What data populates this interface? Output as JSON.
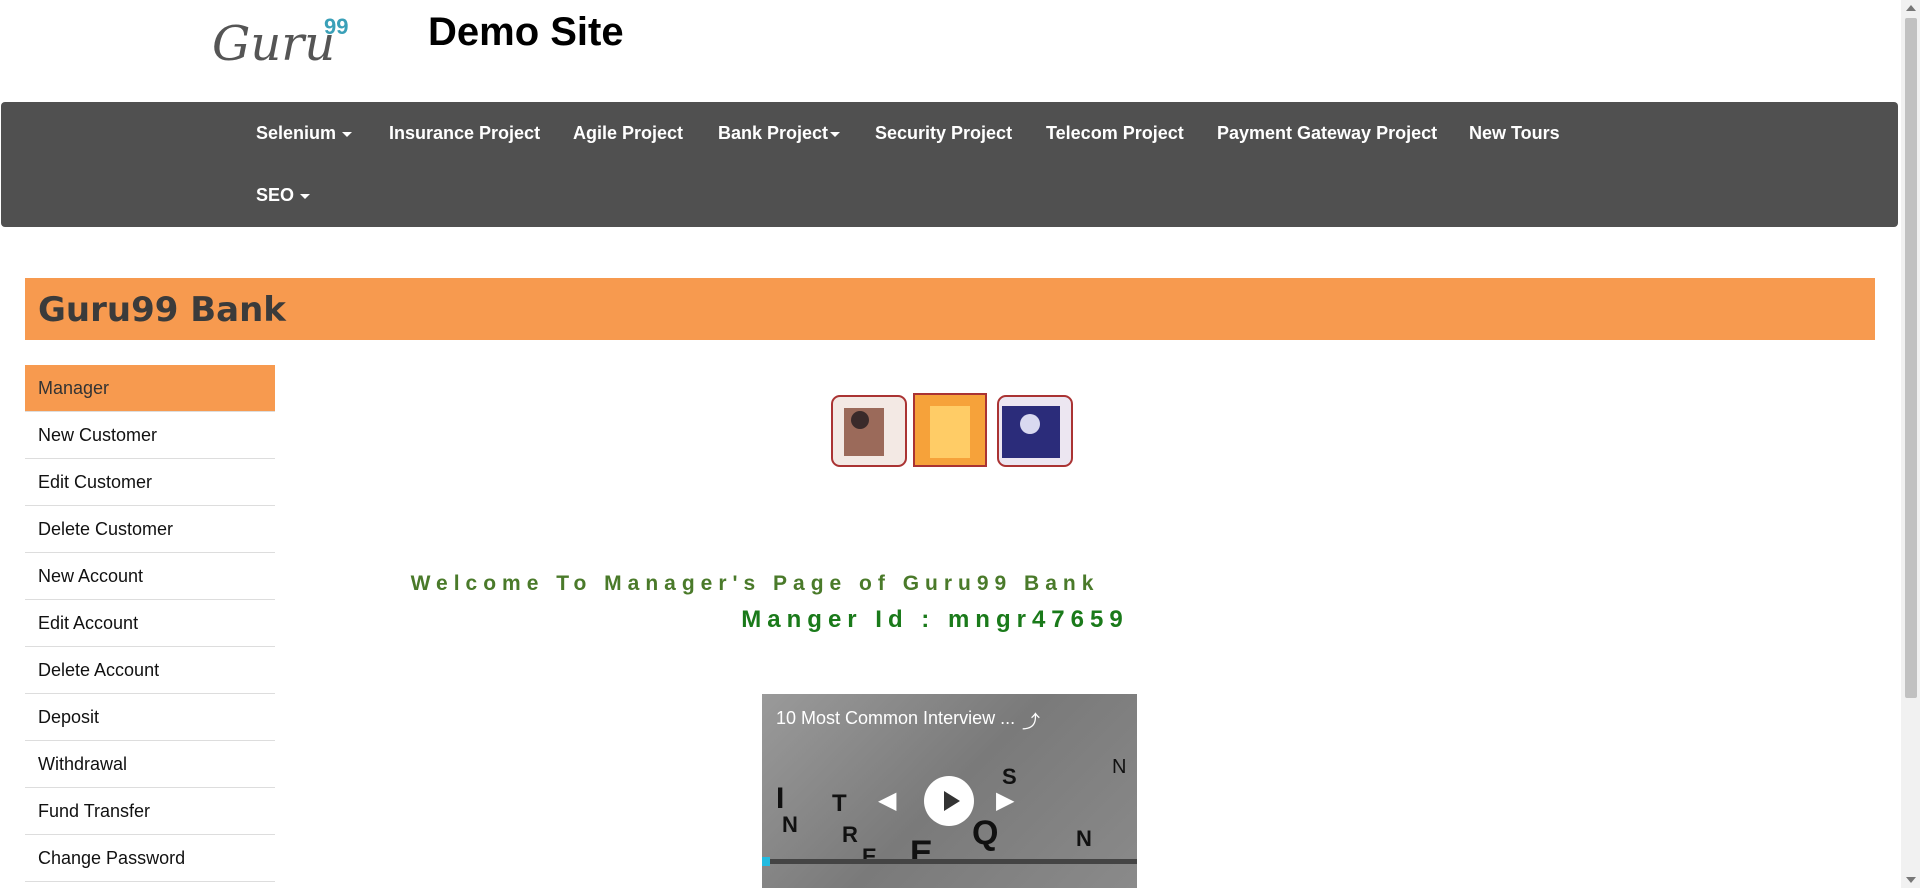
{
  "header": {
    "logo_text": "Guru",
    "logo_sup": "99",
    "site_title": "Demo Site"
  },
  "nav": {
    "items": [
      {
        "label": "Selenium",
        "dropdown": true
      },
      {
        "label": "Insurance Project",
        "dropdown": false
      },
      {
        "label": "Agile Project",
        "dropdown": false
      },
      {
        "label": "Bank Project",
        "dropdown": true
      },
      {
        "label": "Security Project",
        "dropdown": false
      },
      {
        "label": "Telecom Project",
        "dropdown": false
      },
      {
        "label": "Payment Gateway Project",
        "dropdown": false
      },
      {
        "label": "New Tours",
        "dropdown": false
      },
      {
        "label": "SEO",
        "dropdown": true
      }
    ]
  },
  "bank": {
    "title": "Guru99 Bank"
  },
  "menu": {
    "items": [
      "Manager",
      "New Customer",
      "Edit Customer",
      "Delete Customer",
      "New Account",
      "Edit Account",
      "Delete Account",
      "Deposit",
      "Withdrawal",
      "Fund Transfer",
      "Change Password"
    ]
  },
  "main": {
    "welcome": "Welcome To Manager's Page of Guru99 Bank",
    "manager_id": "Manger Id : mngr47659"
  },
  "video": {
    "title": "10 Most Common Interview ...",
    "icons": [
      "share-icon",
      "prev-icon",
      "play-icon",
      "next-icon"
    ]
  },
  "colors": {
    "nav_bg": "#505050",
    "accent": "#f79a4f",
    "welcome": "#4a7a2a",
    "logo_sup": "#3aa0b8"
  }
}
